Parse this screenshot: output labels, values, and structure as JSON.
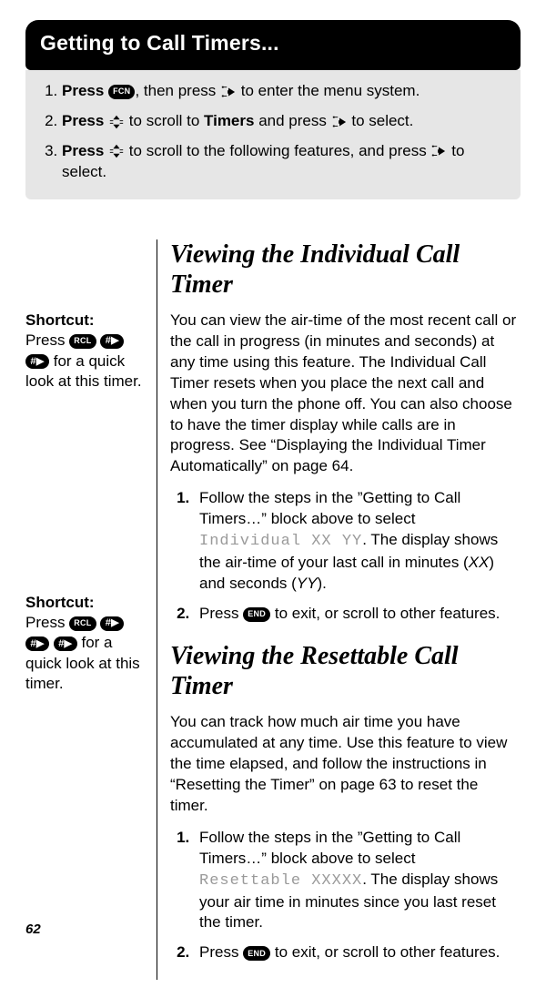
{
  "header": {
    "title": "Getting to Call Timers..."
  },
  "keys": {
    "fcn": "FCN",
    "rcl": "RCL",
    "hash": "#▶",
    "end": "END"
  },
  "steps": {
    "s1a": "Press",
    "s1b": ", then press",
    "s1c": "to enter the menu system.",
    "s2a": "Press",
    "s2b": "to scroll to",
    "s2bold": "Timers",
    "s2c": "and press",
    "s2d": "to select.",
    "s3a": "Press",
    "s3b": "to scroll to the following features, and press",
    "s3c": "to select."
  },
  "sidebar": {
    "shortcut_label": "Shortcut:",
    "press": "Press",
    "s1tail": "for a quick look at this timer.",
    "s2tail": "for a quick look at this timer."
  },
  "sec1": {
    "title": "Viewing the Individual Call Timer",
    "para": "You can view the air-time of the most recent call or the call in progress (in minutes and seconds) at any time using this feature. The Individual Call Timer resets when you place the next call and when you turn the phone off. You can also choose to have the timer display while calls are in progress. See “Displaying the Individual Timer Automatically” on page 64.",
    "step1a": "Follow the steps in the ”Getting to Call Timers…” block above to select",
    "step1mono": "Individual XX YY",
    "step1b": ". The display shows the air-time of your last call in minutes (",
    "step1xx": "XX",
    "step1mid": ") and seconds (",
    "step1yy": "YY",
    "step1end": ").",
    "step2a": "Press",
    "step2b": "to exit, or scroll to other features."
  },
  "sec2": {
    "title": "Viewing the Resettable Call Timer",
    "para": "You can track how much air time you have accumulated at any time. Use this feature to view the time elapsed, and follow the instructions in “Resetting the Timer” on page 63 to reset the timer.",
    "step1a": "Follow the steps in the ”Getting to Call Timers…” block above to select",
    "step1mono": "Resettable XXXXX",
    "step1b": ". The display shows your air time in minutes since you last reset the timer.",
    "step2a": "Press",
    "step2b": "to exit, or scroll to other features."
  },
  "page": {
    "num": "62"
  }
}
